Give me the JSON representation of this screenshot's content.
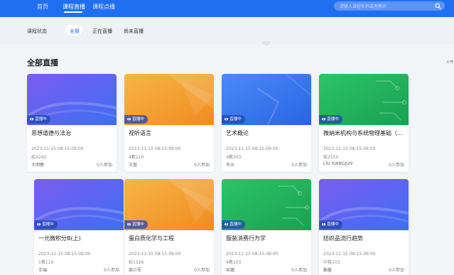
{
  "nav": {
    "items": [
      {
        "label": "首页",
        "active": false
      },
      {
        "label": "课程直播",
        "active": true
      },
      {
        "label": "课程点播",
        "active": false
      }
    ],
    "search_placeholder": "请输入课程名称或者教师"
  },
  "filter": {
    "label": "课程状态",
    "tabs": [
      {
        "label": "全部",
        "active": true
      },
      {
        "label": "正在直播",
        "active": false
      },
      {
        "label": "尚未直播",
        "active": false
      }
    ]
  },
  "section": {
    "title": "全部直播",
    "edge_text": "人气"
  },
  "colors": {
    "primary": "#1f6ff0",
    "cover_blue": "#4a6ef0",
    "cover_orange": "#f5a623",
    "cover_green": "#22b25c"
  },
  "cards": [
    {
      "title": "思想道德与法治",
      "badge": "直播中",
      "time": "2023-11-15 08:15-09:00",
      "room": "松2242",
      "teacher": "王明春",
      "count": "0人参加",
      "theme": "purple"
    },
    {
      "title": "视听语言",
      "badge": "直播中",
      "time": "2023-11-15 08:15-09:00",
      "room": "4教110",
      "teacher": "王茵",
      "count": "0人参加",
      "theme": "orange"
    },
    {
      "title": "艺术概论",
      "badge": "直播中",
      "time": "2023-11-15 08:15-09:00",
      "room": "4教203",
      "teacher": "毕沙",
      "count": "0人参加",
      "theme": "blue"
    },
    {
      "title": "微纳米机构与系统物理基础（...",
      "badge": "直播中",
      "time": "2023-11-15 08:15-09:00",
      "room": "松2150",
      "teacher": "LIU XIANGJUN",
      "count": "0人参加",
      "theme": "green"
    },
    {
      "title": "一元微积分B(上)",
      "badge": "直播中",
      "time": "2023-11-15 08:15-09:00",
      "room": "1教119",
      "teacher": "王瑞",
      "count": "0人参加",
      "theme": "purple"
    },
    {
      "title": "蛋白质化学与工程",
      "badge": "直播中",
      "time": "2023-11-15 08:15-09:00",
      "room": "松1526",
      "teacher": "周小军",
      "count": "0人参加",
      "theme": "orange"
    },
    {
      "title": "服装消费行为学",
      "badge": "直播中",
      "time": "2023-11-15 08:15-09:00",
      "room": "4教103",
      "teacher": "宋璐",
      "count": "0人参加",
      "theme": "green"
    },
    {
      "title": "纺织品流行趋势",
      "badge": "直播中",
      "time": "2023-11-15 08:15-09:00",
      "room": "中楼103",
      "teacher": "鞠量",
      "count": "0人参加",
      "theme": "purple"
    }
  ]
}
